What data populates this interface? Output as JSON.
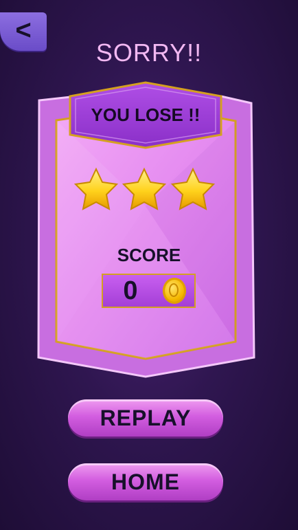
{
  "header": {
    "back_symbol": "<",
    "title": "SORRY!!"
  },
  "result_panel": {
    "badge_text": "YOU LOSE !!",
    "stars_earned": 3,
    "stars_total": 3,
    "score_label": "SCORE",
    "score_value": "0"
  },
  "actions": {
    "replay_label": "REPLAY",
    "home_label": "HOME"
  },
  "colors": {
    "background": "#2f1650",
    "panel": "#e58cf0",
    "gold": "#d4a020",
    "title_text": "#f2b8f2",
    "star": "#ffd21c"
  },
  "icons": [
    "back-chevron-icon",
    "star-icon",
    "coin-icon"
  ]
}
